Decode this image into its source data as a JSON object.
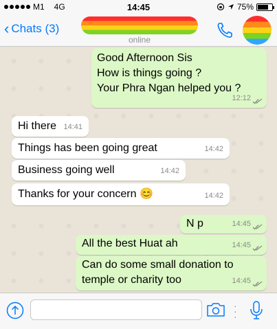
{
  "status_bar": {
    "carrier": "M1",
    "network": "4G",
    "time": "14:45",
    "battery": "75%",
    "battery_level": 0.75,
    "signal_bars": 5
  },
  "nav": {
    "back_label": "Chats (3)",
    "subtitle": "online"
  },
  "messages": [
    {
      "direction": "out",
      "text": "Good Afternoon Sis\nHow is things going ?\nYour Phra Ngan helped you ?",
      "time": "12:12",
      "read": true
    },
    {
      "direction": "in",
      "text": "Hi there",
      "time": "14:41"
    },
    {
      "direction": "in",
      "text": "Things has been going great",
      "time": "14:42"
    },
    {
      "direction": "in",
      "text": "Business going well",
      "time": "14:42"
    },
    {
      "direction": "in",
      "text": "Thanks for your concern 😊",
      "time": "14:42"
    },
    {
      "direction": "out",
      "text": "N p",
      "time": "14:45",
      "read": true
    },
    {
      "direction": "out",
      "text": "All the best Huat ah",
      "time": "14:45",
      "read": true
    },
    {
      "direction": "out",
      "text": "Can do some small donation to\ntemple or charity too",
      "time": "14:45",
      "read": true
    }
  ],
  "input": {
    "placeholder": "",
    "value": ""
  },
  "colors": {
    "accent": "#007aff",
    "outgoing_bubble": "#dcf8c6",
    "incoming_bubble": "#ffffff",
    "read_tick": "#8a8a8a",
    "chat_background": "#e9e3d8"
  },
  "icons": {
    "back": "chevron-left-icon",
    "call": "phone-icon",
    "attach": "arrow-up-circle-icon",
    "camera": "camera-icon",
    "mic": "microphone-icon",
    "location": "location-arrow-icon"
  }
}
